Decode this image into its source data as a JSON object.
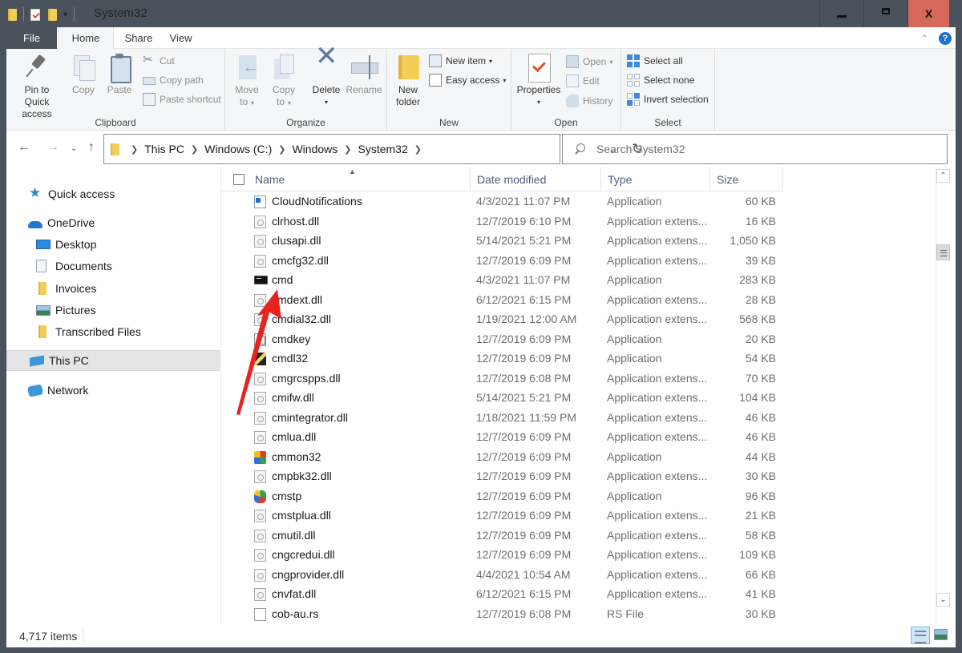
{
  "window": {
    "title": "System32",
    "controls": {
      "minimize": "minimize",
      "maximize": "maximize",
      "close": "X"
    }
  },
  "ribbon": {
    "tabs": [
      {
        "label": "File"
      },
      {
        "label": "Home",
        "active": true
      },
      {
        "label": "Share"
      },
      {
        "label": "View"
      }
    ],
    "help": "?",
    "groups": {
      "clipboard": {
        "label": "Clipboard",
        "pin": "Pin to Quick",
        "pin2": "access",
        "copy": "Copy",
        "paste": "Paste",
        "cut": "Cut",
        "copy_path": "Copy path",
        "paste_shortcut": "Paste shortcut"
      },
      "organize": {
        "label": "Organize",
        "move_to": "Move",
        "move_to2": "to",
        "copy_to": "Copy",
        "copy_to2": "to",
        "delete": "Delete",
        "rename": "Rename"
      },
      "new": {
        "label": "New",
        "new_folder": "New",
        "new_folder2": "folder",
        "new_item": "New item",
        "easy_access": "Easy access"
      },
      "open": {
        "label": "Open",
        "properties": "Properties",
        "open": "Open",
        "edit": "Edit",
        "history": "History"
      },
      "select": {
        "label": "Select",
        "select_all": "Select all",
        "select_none": "Select none",
        "invert": "Invert selection"
      }
    }
  },
  "address": {
    "breadcrumb": [
      "This PC",
      "Windows (C:)",
      "Windows",
      "System32"
    ],
    "search_placeholder": "Search System32"
  },
  "navpane": {
    "items": [
      {
        "label": "Quick access",
        "icon": "star-icon"
      },
      {
        "label": "OneDrive",
        "icon": "cloud-icon"
      },
      {
        "label": "Desktop",
        "icon": "desktop-icon"
      },
      {
        "label": "Documents",
        "icon": "documents-icon"
      },
      {
        "label": "Invoices",
        "icon": "folder-icon"
      },
      {
        "label": "Pictures",
        "icon": "pictures-icon"
      },
      {
        "label": "Transcribed Files",
        "icon": "folder-icon"
      },
      {
        "label": "This PC",
        "icon": "computer-icon",
        "selected": true
      },
      {
        "label": "Network",
        "icon": "network-icon"
      }
    ]
  },
  "filelist": {
    "columns": [
      "Name",
      "Date modified",
      "Type",
      "Size"
    ],
    "sorted_by": "Name",
    "rows": [
      {
        "name": "CloudNotifications",
        "date": "4/3/2021 11:07 PM",
        "type": "Application",
        "size": "60 KB",
        "icon": "app"
      },
      {
        "name": "clrhost.dll",
        "date": "12/7/2019 6:10 PM",
        "type": "Application extens...",
        "size": "16 KB",
        "icon": "dll"
      },
      {
        "name": "clusapi.dll",
        "date": "5/14/2021 5:21 PM",
        "type": "Application extens...",
        "size": "1,050 KB",
        "icon": "dll"
      },
      {
        "name": "cmcfg32.dll",
        "date": "12/7/2019 6:09 PM",
        "type": "Application extens...",
        "size": "39 KB",
        "icon": "dll"
      },
      {
        "name": "cmd",
        "date": "4/3/2021 11:07 PM",
        "type": "Application",
        "size": "283 KB",
        "icon": "cmd"
      },
      {
        "name": "cmdext.dll",
        "date": "6/12/2021 6:15 PM",
        "type": "Application extens...",
        "size": "28 KB",
        "icon": "dll"
      },
      {
        "name": "cmdial32.dll",
        "date": "1/19/2021 12:00 AM",
        "type": "Application extens...",
        "size": "568 KB",
        "icon": "dll"
      },
      {
        "name": "cmdkey",
        "date": "12/7/2019 6:09 PM",
        "type": "Application",
        "size": "20 KB",
        "icon": "key"
      },
      {
        "name": "cmdl32",
        "date": "12/7/2019 6:09 PM",
        "type": "Application",
        "size": "54 KB",
        "icon": "dl"
      },
      {
        "name": "cmgrcspps.dll",
        "date": "12/7/2019 6:08 PM",
        "type": "Application extens...",
        "size": "70 KB",
        "icon": "dll"
      },
      {
        "name": "cmifw.dll",
        "date": "5/14/2021 5:21 PM",
        "type": "Application extens...",
        "size": "104 KB",
        "icon": "dll"
      },
      {
        "name": "cmintegrator.dll",
        "date": "1/18/2021 11:59 PM",
        "type": "Application extens...",
        "size": "46 KB",
        "icon": "dll"
      },
      {
        "name": "cmlua.dll",
        "date": "12/7/2019 6:09 PM",
        "type": "Application extens...",
        "size": "46 KB",
        "icon": "dll"
      },
      {
        "name": "cmmon32",
        "date": "12/7/2019 6:09 PM",
        "type": "Application",
        "size": "44 KB",
        "icon": "mon"
      },
      {
        "name": "cmpbk32.dll",
        "date": "12/7/2019 6:09 PM",
        "type": "Application extens...",
        "size": "30 KB",
        "icon": "dll"
      },
      {
        "name": "cmstp",
        "date": "12/7/2019 6:09 PM",
        "type": "Application",
        "size": "96 KB",
        "icon": "stp"
      },
      {
        "name": "cmstplua.dll",
        "date": "12/7/2019 6:09 PM",
        "type": "Application extens...",
        "size": "21 KB",
        "icon": "dll"
      },
      {
        "name": "cmutil.dll",
        "date": "12/7/2019 6:09 PM",
        "type": "Application extens...",
        "size": "58 KB",
        "icon": "dll"
      },
      {
        "name": "cngcredui.dll",
        "date": "12/7/2019 6:09 PM",
        "type": "Application extens...",
        "size": "109 KB",
        "icon": "dll"
      },
      {
        "name": "cngprovider.dll",
        "date": "4/4/2021 10:54 AM",
        "type": "Application extens...",
        "size": "66 KB",
        "icon": "dll"
      },
      {
        "name": "cnvfat.dll",
        "date": "6/12/2021 6:15 PM",
        "type": "Application extens...",
        "size": "41 KB",
        "icon": "dll"
      },
      {
        "name": "cob-au.rs",
        "date": "12/7/2019 6:08 PM",
        "type": "RS File",
        "size": "30 KB",
        "icon": "file"
      }
    ]
  },
  "statusbar": {
    "item_count": "4,717 items"
  },
  "annotation": {
    "type": "red-arrow",
    "points_to": "cmd",
    "color": "#e8231f"
  }
}
